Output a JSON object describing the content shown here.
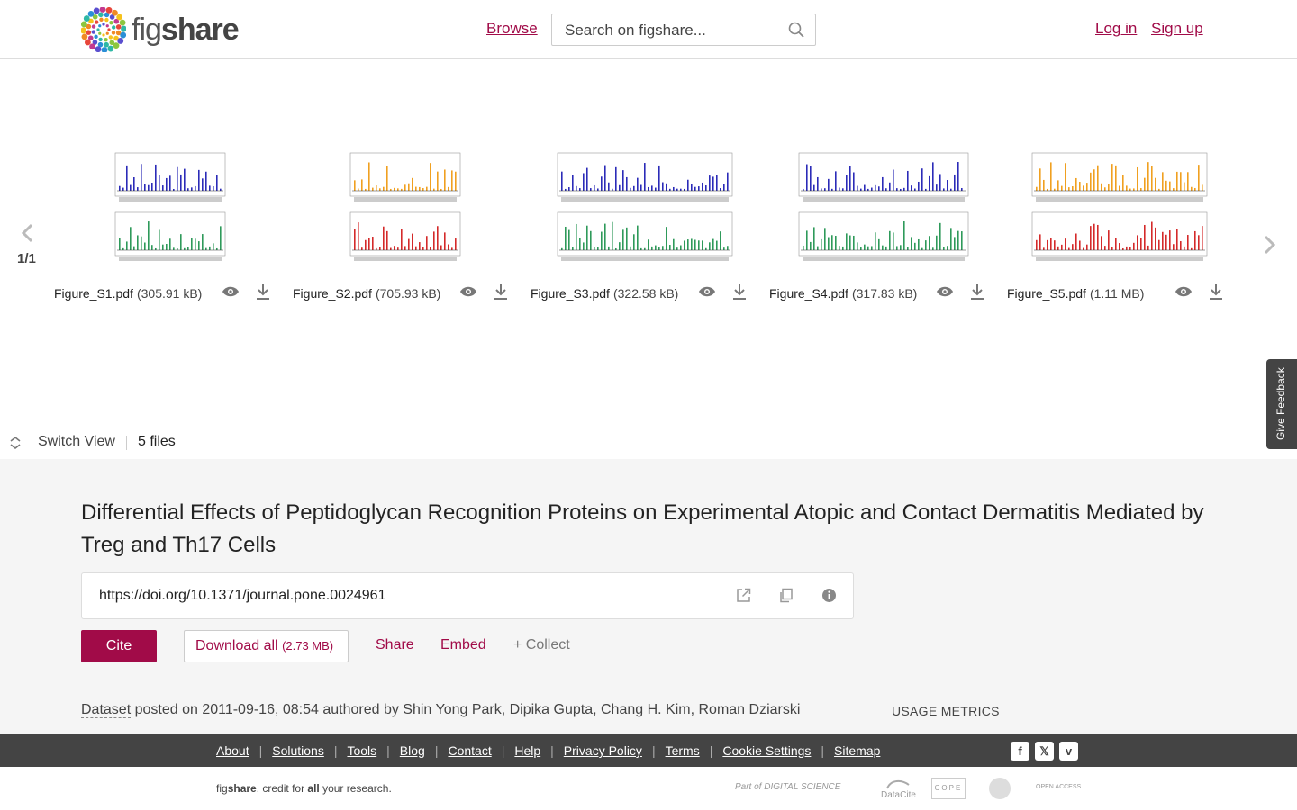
{
  "header": {
    "logo_text_light": "fig",
    "logo_text_bold": "share",
    "browse_label": "Browse",
    "search_placeholder": "Search on figshare...",
    "login_label": "Log in",
    "signup_label": "Sign up"
  },
  "carousel": {
    "pager": "1/1",
    "files": [
      {
        "name": "Figure_S1.pdf",
        "size": "(305.91 kB)",
        "colors": [
          "#2b2bb8",
          "#2e9a5a"
        ]
      },
      {
        "name": "Figure_S2.pdf",
        "size": "(705.93 kB)",
        "colors": [
          "#f0a020",
          "#d42a2a"
        ]
      },
      {
        "name": "Figure_S3.pdf",
        "size": "(322.58 kB)",
        "colors": [
          "#2b2bb8",
          "#2e9a5a"
        ]
      },
      {
        "name": "Figure_S4.pdf",
        "size": "(317.83 kB)",
        "colors": [
          "#2b2bb8",
          "#2e9a5a"
        ]
      },
      {
        "name": "Figure_S5.pdf",
        "size": "(1.11 MB)",
        "colors": [
          "#f0a020",
          "#d42a2a"
        ]
      }
    ],
    "feedback_label": "Give Feedback",
    "switch_view_label": "Switch View",
    "files_count": "5 files"
  },
  "article": {
    "title": "Differential Effects of Peptidoglycan Recognition Proteins on Experimental Atopic and Contact Dermatitis Mediated by Treg and Th17 Cells",
    "doi": "https://doi.org/10.1371/journal.pone.0024961",
    "cite_label": "Cite",
    "download_label": "Download all",
    "download_size": "(2.73 MB)",
    "share_label": "Share",
    "embed_label": "Embed",
    "collect_label": "+ Collect",
    "item_type": "Dataset",
    "posted_text": "posted on 2011-09-16, 08:54 authored by Shin Yong Park, Dipika Gupta, Chang H. Kim, Roman Dziarski",
    "usage_label": "USAGE METRICS"
  },
  "footer": {
    "links": [
      "About",
      "Solutions",
      "Tools",
      "Blog",
      "Contact",
      "Help",
      "Privacy Policy",
      "Terms",
      "Cookie Settings",
      "Sitemap"
    ],
    "tagline_a": "fig",
    "tagline_b": "share",
    "tagline_c": ". credit for ",
    "tagline_d": "all",
    "tagline_e": " your research.",
    "partners": [
      "Part of DIGITAL SCIENCE",
      "DataCite",
      "COPE",
      "OPEN ACCESS"
    ]
  },
  "colors": {
    "brand": "#a10b48",
    "footer_bg": "#444444",
    "section_bg": "#f5f5f5"
  }
}
